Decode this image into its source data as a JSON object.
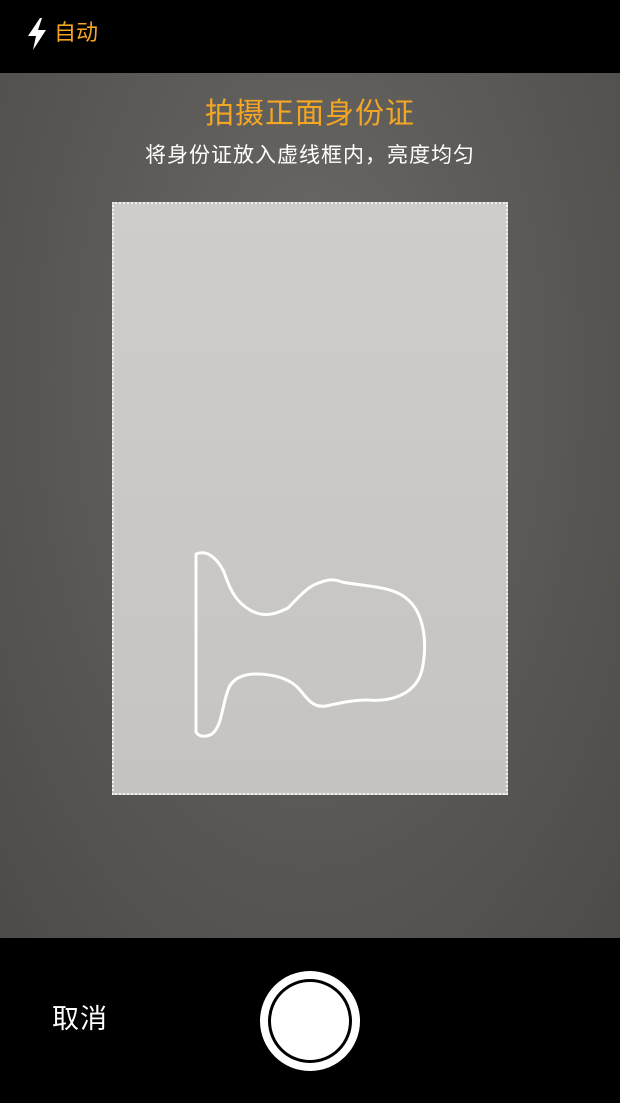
{
  "colors": {
    "accent": "#F5A623",
    "text_white": "#FFFFFF",
    "bar_background": "#000000"
  },
  "top_bar": {
    "flash_icon": "lightning-bolt-icon",
    "flash_label": "自动"
  },
  "guide": {
    "title": "拍摄正面身份证",
    "subtitle": "将身份证放入虚线框内，亮度均匀"
  },
  "bottom_bar": {
    "cancel_label": "取消",
    "shutter_icon": "shutter-button-icon"
  }
}
